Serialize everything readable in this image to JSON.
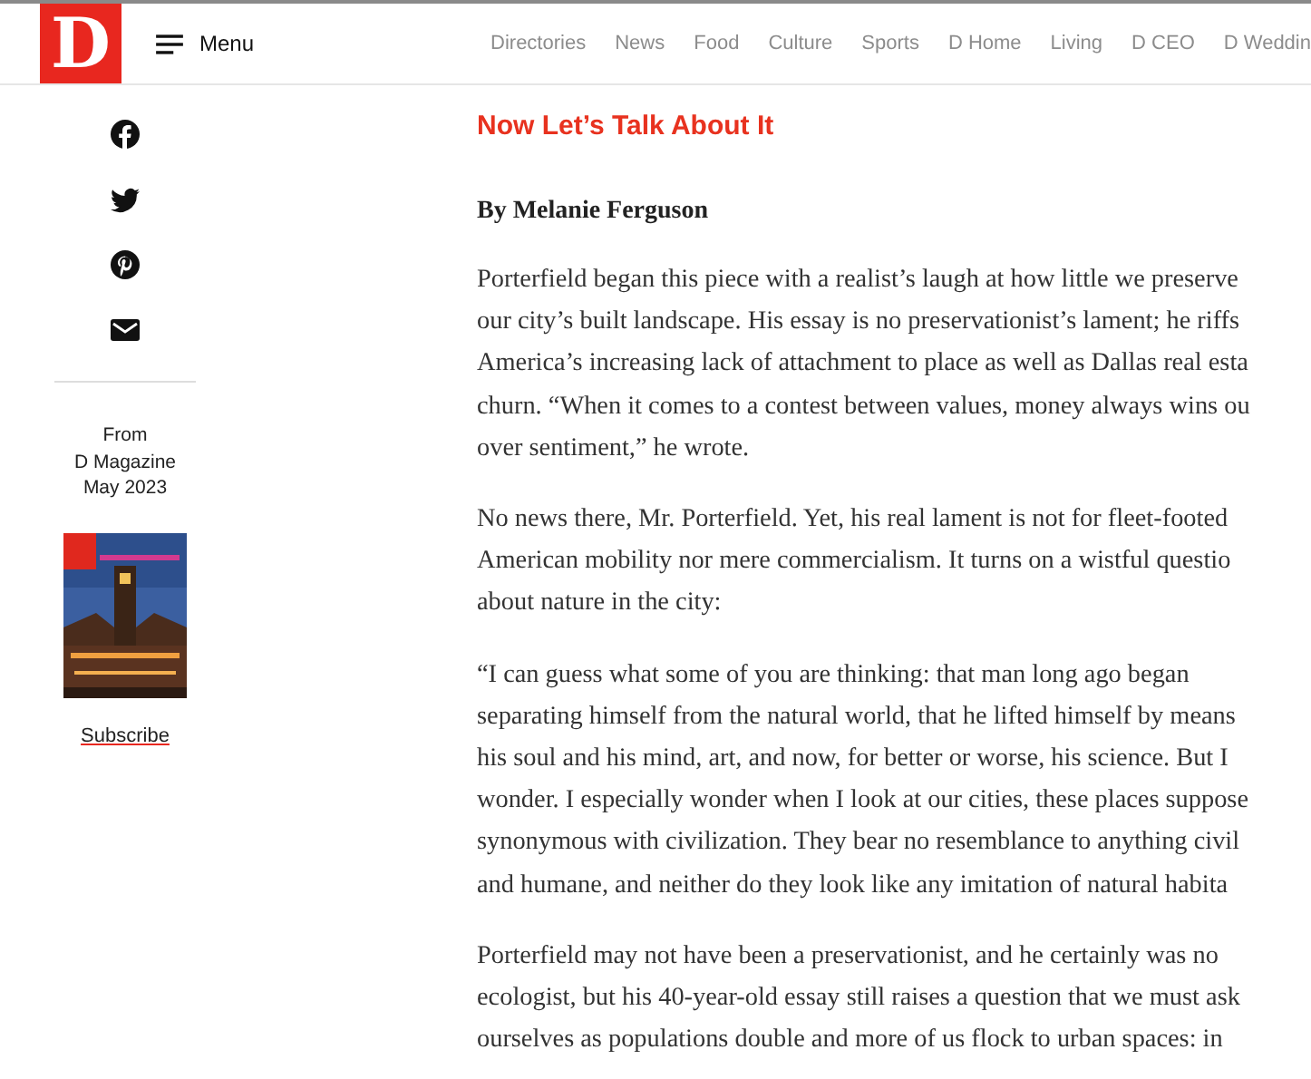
{
  "header": {
    "logo": "D",
    "menu_label": "Menu",
    "nav": [
      "Directories",
      "News",
      "Food",
      "Culture",
      "Sports",
      "D Home",
      "Living",
      "D CEO",
      "D Weddin"
    ]
  },
  "share": [
    {
      "kind": "facebook"
    },
    {
      "kind": "twitter"
    },
    {
      "kind": "pinterest"
    },
    {
      "kind": "email"
    }
  ],
  "issue": {
    "lines": [
      "From",
      "D Magazine",
      "May 2023"
    ],
    "cover": {
      "kind": "picture"
    },
    "subscribe": "Subscribe"
  },
  "article": {
    "headline": "Now Let’s Talk About It",
    "byline": "By Melanie Ferguson",
    "paragraphs": [
      {
        "lines": [
          "Porterfield began this piece with a realist’s laugh at how little we preserve",
          "our city’s built landscape. His essay is no preservationist’s lament; he riffs",
          "America’s increasing lack of attachment to place as well as Dallas real esta",
          "churn. “When it comes to a contest between values, money always wins ou",
          "over sentiment,” he wrote."
        ]
      },
      {
        "lines": [
          "No news there, Mr. Porterfield. Yet, his real lament is not for fleet-footed",
          "American mobility nor mere commercialism. It turns on a wistful questio",
          "about nature in the city:"
        ]
      },
      {
        "lines": [
          "“I can guess what some of you are thinking: that man long ago began",
          "separating himself from the natural world, that he lifted himself by means",
          "his soul and his mind, art, and now, for better or worse, his science. But I",
          "wonder. I especially wonder when I look at our cities, these places suppose",
          "synonymous with civilization. They bear no resemblance to anything civil",
          "and humane, and neither do they look like any imitation of natural habita"
        ]
      },
      {
        "lines": [
          "Porterfield may not have been a preservationist, and he certainly was no",
          "ecologist, but his 40-year-old essay still raises a question that we must ask",
          "ourselves as populations double and more of us flock to urban spaces: in"
        ]
      }
    ]
  }
}
